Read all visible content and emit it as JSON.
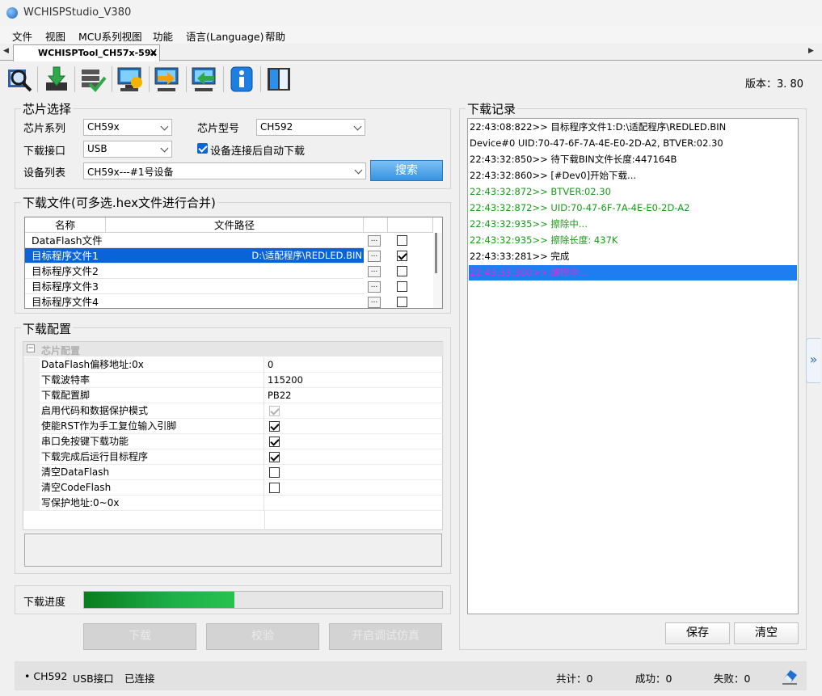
{
  "window": {
    "title": "WCHISPStudio_V380"
  },
  "menu": [
    "文件",
    "视图",
    "MCU系列视图",
    "功能",
    "语言(Language)",
    "帮助"
  ],
  "tab": {
    "label": "WCHISPTool_CH57x-59x",
    "close": "×"
  },
  "toolbar": {
    "icons": [
      "search-chip-icon",
      "download-icon",
      "verify-icon",
      "refresh-device-icon",
      "export-icon",
      "import-icon",
      "info-icon",
      "book-icon"
    ],
    "version_label": "版本：3. 80"
  },
  "chip_select": {
    "title": "芯片选择",
    "series_label": "芯片系列",
    "series_value": "CH59x",
    "model_label": "芯片型号",
    "model_value": "CH592",
    "interface_label": "下载接口",
    "interface_value": "USB",
    "auto_download_label": "设备连接后自动下载",
    "auto_download_checked": true,
    "device_list_label": "设备列表",
    "device_list_value": "CH59x---#1号设备",
    "search_button": "搜索"
  },
  "download_files": {
    "title": "下载文件(可多选.hex文件进行合并)",
    "headers": [
      "名称",
      "文件路径"
    ],
    "rows": [
      {
        "name": "DataFlash文件",
        "path": "",
        "checked": false,
        "selected": false
      },
      {
        "name": "目标程序文件1",
        "path": "D:\\适配程序\\REDLED.BIN",
        "checked": true,
        "selected": true
      },
      {
        "name": "目标程序文件2",
        "path": "",
        "checked": false,
        "selected": false
      },
      {
        "name": "目标程序文件3",
        "path": "",
        "checked": false,
        "selected": false
      },
      {
        "name": "目标程序文件4",
        "path": "",
        "checked": false,
        "selected": false
      }
    ],
    "browse": "..."
  },
  "download_config": {
    "title": "下载配置",
    "category": "芯片配置",
    "rows": [
      {
        "name": "DataFlash偏移地址:0x",
        "value": "0"
      },
      {
        "name": "下载波特率",
        "value": "115200"
      },
      {
        "name": "下载配置脚",
        "value": "PB22"
      },
      {
        "name": "启用代码和数据保护模式",
        "check": "disabled"
      },
      {
        "name": "使能RST作为手工复位输入引脚",
        "check": "on"
      },
      {
        "name": "串口免按键下载功能",
        "check": "on"
      },
      {
        "name": "下载完成后运行目标程序",
        "check": "on"
      },
      {
        "name": "清空DataFlash",
        "check": "off"
      },
      {
        "name": "清空CodeFlash",
        "check": "off"
      },
      {
        "name": "写保护地址:0~0x",
        "value": ""
      }
    ]
  },
  "progress": {
    "label": "下载进度",
    "fraction": 0.42
  },
  "actions": {
    "download": "下载",
    "verify": "校验",
    "sim": "开启调试仿真"
  },
  "log": {
    "title": "下载记录",
    "colors": {
      "black": "#000000",
      "green": "#1a9a1a",
      "magenta": "#d62fd6"
    },
    "lines": [
      {
        "text": "22:43:08:822>> 目标程序文件1:D:\\适配程序\\REDLED.BIN",
        "color": "black"
      },
      {
        "text": "Device#0  UID:70-47-6F-7A-4E-E0-2D-A2, BTVER:02.30",
        "color": "black"
      },
      {
        "text": "22:43:32:850>> 待下载BIN文件长度:447164B",
        "color": "black"
      },
      {
        "text": "22:43:32:860>> [#Dev0]开始下载...",
        "color": "black"
      },
      {
        "text": "22:43:32:872>> BTVER:02.30",
        "color": "green"
      },
      {
        "text": "22:43:32:872>> UID:70-47-6F-7A-4E-E0-2D-A2",
        "color": "green"
      },
      {
        "text": "22:43:32:935>> 擦除中...",
        "color": "green"
      },
      {
        "text": "22:43:32:935>> 擦除长度: 437K",
        "color": "green"
      },
      {
        "text": "22:43:33:281>> 完成",
        "color": "black"
      },
      {
        "text": "22:43:33:300>> 编程中...",
        "color": "magenta",
        "selected": true
      }
    ],
    "save_button": "保存",
    "clear_button": "清空"
  },
  "status": {
    "chip": "• CH592",
    "interface": "USB接口",
    "connection": "已连接",
    "total": "共计：0",
    "success": "成功：0",
    "fail": "失败：0"
  },
  "side_tab": "»"
}
